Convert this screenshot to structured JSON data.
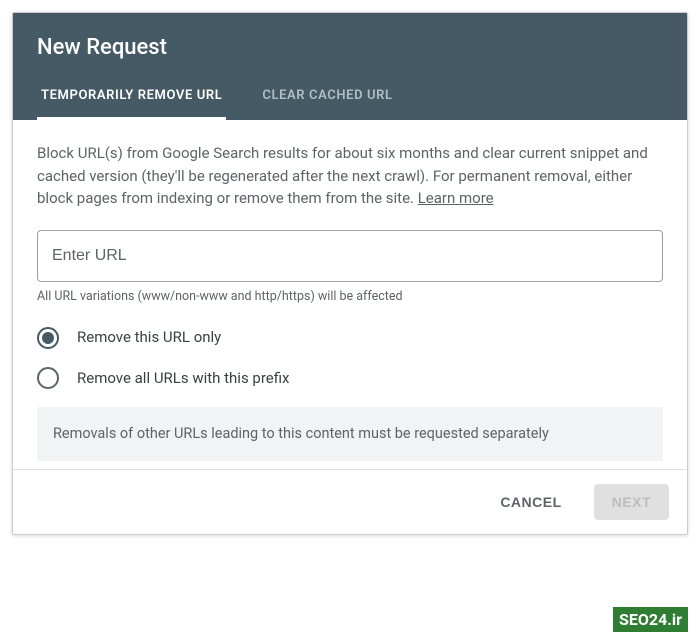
{
  "dialog": {
    "title": "New Request",
    "tabs": [
      {
        "label": "TEMPORARILY REMOVE URL",
        "active": true
      },
      {
        "label": "CLEAR CACHED URL",
        "active": false
      }
    ],
    "description": "Block URL(s) from Google Search results for about six months and clear current snippet and cached version (they'll be regenerated after the next crawl). For permanent removal, either block pages from indexing or remove them from the site. ",
    "learn_more_label": "Learn more",
    "url_input": {
      "placeholder": "Enter URL",
      "value": ""
    },
    "hint": "All URL variations (www/non-www and http/https) will be affected",
    "options": [
      {
        "label": "Remove this URL only",
        "selected": true
      },
      {
        "label": "Remove all URLs with this prefix",
        "selected": false
      }
    ],
    "note": "Removals of other URLs leading to this content must be requested separately",
    "footer": {
      "cancel_label": "CANCEL",
      "next_label": "NEXT"
    }
  },
  "watermark": "SEO24.ir"
}
